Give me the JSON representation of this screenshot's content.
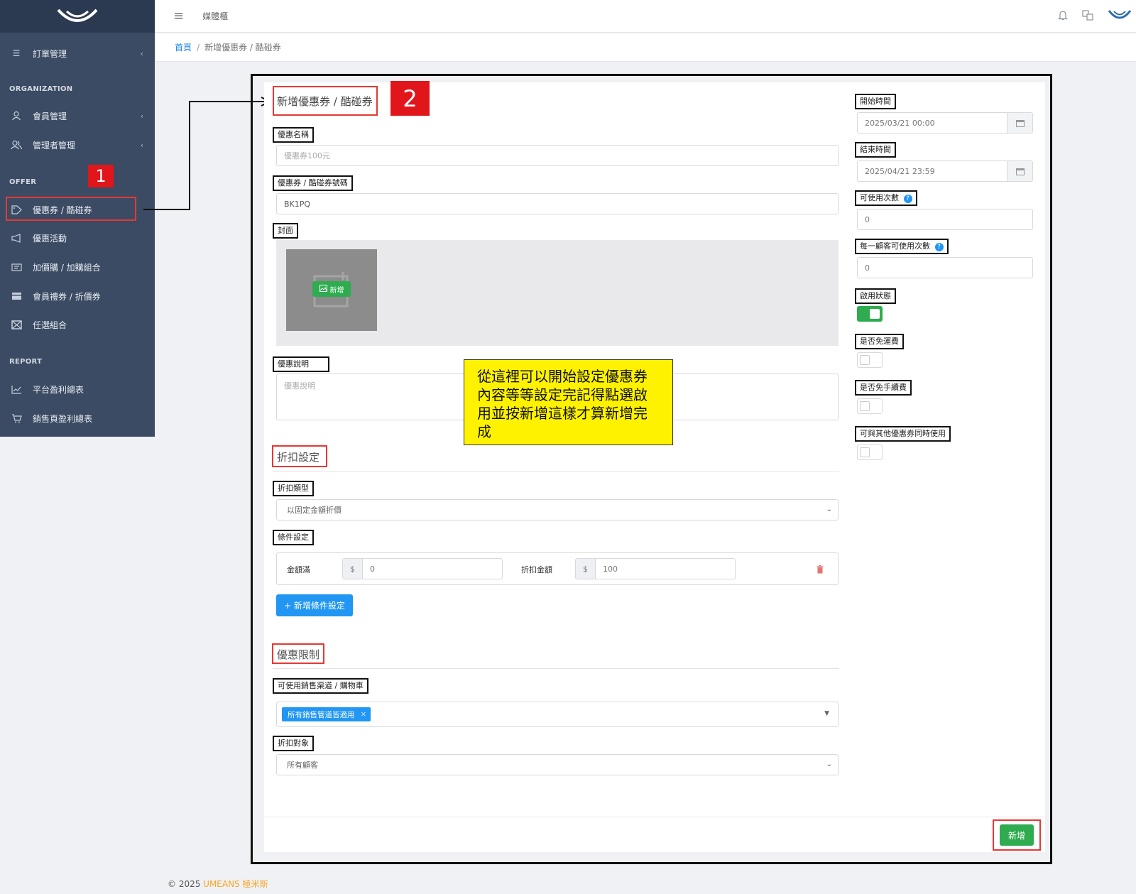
{
  "topbar": {
    "label": "媒體櫃"
  },
  "breadcrumb": {
    "home": "首頁",
    "current": "新增優惠券 / 酷碰券"
  },
  "sidebar": {
    "items": [
      {
        "label": "訂單管理"
      },
      {
        "label": "會員管理"
      },
      {
        "label": "管理者管理"
      },
      {
        "label": "優惠券 / 酷碰券"
      },
      {
        "label": "優惠活動"
      },
      {
        "label": "加價購 / 加購組合"
      },
      {
        "label": "會員禮券 / 折價券"
      },
      {
        "label": "任選組合"
      },
      {
        "label": "平台盈利總表"
      },
      {
        "label": "銷售頁盈利總表"
      }
    ],
    "sections": {
      "org": "ORGANIZATION",
      "offer": "OFFER",
      "report": "REPORT"
    }
  },
  "annotations": {
    "step1": "1",
    "step2": "2",
    "note": "從這裡可以開始設定優惠券內容等等設定完記得點選啟用並按新增這樣才算新增完成"
  },
  "form": {
    "title": "新增優惠券 / 酷碰券",
    "name_label": "優惠名稱",
    "name_placeholder": "優惠券100元",
    "code_label": "優惠券 / 酷碰券號碼",
    "code_value": "BK1PQ",
    "cover_label": "封面",
    "cover_add": "新增",
    "desc_label": "優惠說明",
    "desc_placeholder": "優惠說明",
    "discount_section": "折扣設定",
    "discount_type_label": "折扣類型",
    "discount_type_value": "以固定金額折價",
    "condition_label": "條件設定",
    "cond_amount_label": "金額滿",
    "cond_amount_value": "0",
    "cond_discount_label": "折扣金額",
    "cond_discount_value": "100",
    "currency": "$",
    "add_condition": "+ 新增條件設定",
    "limit_section": "優惠限制",
    "channel_label": "可使用銷售渠道 / 購物車",
    "channel_tag": "所有銷售管道皆適用",
    "channel_tag_remove": "×",
    "target_label": "折扣對象",
    "target_value": "所有顧客"
  },
  "side_form": {
    "start_label": "開始時間",
    "start_value": "2025/03/21 00:00",
    "end_label": "結束時間",
    "end_value": "2025/04/21 23:59",
    "usage_label": "可使用次數",
    "usage_value": "0",
    "per_customer_label": "每一顧客可使用次數",
    "per_customer_value": "0",
    "enabled_label": "啟用狀態",
    "enabled": true,
    "free_shipping_label": "是否免運費",
    "free_shipping": false,
    "free_fee_label": "是否免手續費",
    "free_fee": false,
    "stackable_label": "可與其他優惠券同時使用",
    "stackable": false
  },
  "buttons": {
    "submit": "新增"
  },
  "footer": {
    "copyright": "© 2025 ",
    "brand": "UMEANS 極米斯"
  },
  "colors": {
    "sidebar": "#3b4b63",
    "accent_green": "#2eac4f",
    "accent_blue": "#2196f3",
    "annotation_red": "#e0161a",
    "note_yellow": "#fff200"
  }
}
